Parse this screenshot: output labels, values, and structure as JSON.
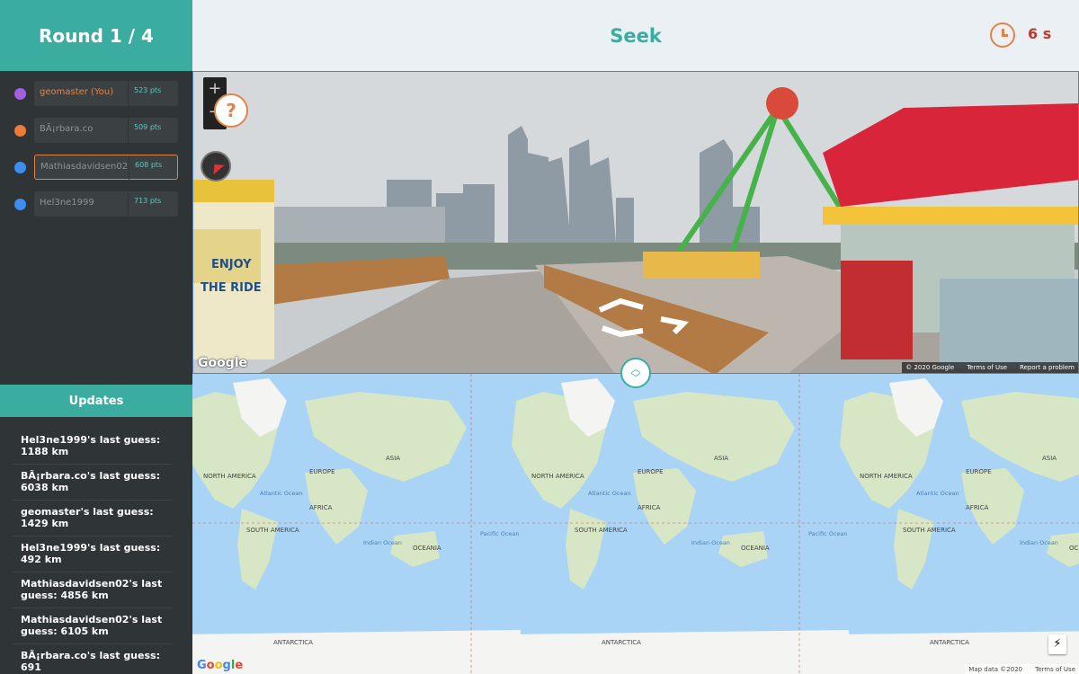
{
  "round": {
    "label": "Round 1 / 4"
  },
  "header": {
    "title": "Seek",
    "timer": "6 s",
    "clock_icon": "clock-icon"
  },
  "players": [
    {
      "name": "geomaster (You)",
      "points": "523 pts",
      "color": "#a55fe0",
      "is_you": true,
      "selected": false
    },
    {
      "name": "BÃ¡rbara.co",
      "points": "509 pts",
      "color": "#ef7a3a",
      "is_you": false,
      "selected": false
    },
    {
      "name": "Mathiasdavidsen02",
      "points": "608 pts",
      "color": "#3d8ef0",
      "is_you": false,
      "selected": true
    },
    {
      "name": "Hel3ne1999",
      "points": "713 pts",
      "color": "#3d8ef0",
      "is_you": false,
      "selected": false
    }
  ],
  "updates": {
    "title": "Updates",
    "items": [
      "Hel3ne1999's last guess: 1188 km",
      "BÃ¡rbara.co's last guess: 6038 km",
      "geomaster's last guess: 1429 km",
      "Hel3ne1999's last guess: 492 km",
      "Mathiasdavidsen02's last guess: 4856 km",
      "Mathiasdavidsen02's last guess: 6105 km",
      "BÃ¡rbara.co's last guess: 691"
    ]
  },
  "streetview": {
    "zoom_in": "+",
    "zoom_out": "−",
    "help": "?",
    "logo": "Google",
    "copyright": "© 2020 Google",
    "terms": "Terms of Use",
    "report": "Report a problem",
    "sign_text": [
      "ENJOY",
      "THE RIDE"
    ]
  },
  "map": {
    "logo": "Google",
    "map_data": "Map data ©2020",
    "terms": "Terms of Use",
    "continents": [
      "NORTH AMERICA",
      "EUROPE",
      "ASIA",
      "AFRICA",
      "SOUTH AMERICA",
      "OCEANIA",
      "ANTARCTICA"
    ],
    "oceans": [
      "Atlantic Ocean",
      "Pacific Ocean",
      "Indian Ocean"
    ]
  },
  "colors": {
    "accent": "#3aada0",
    "you": "#e2834a",
    "timer": "#c0392b",
    "sidebar": "#2f3436"
  }
}
